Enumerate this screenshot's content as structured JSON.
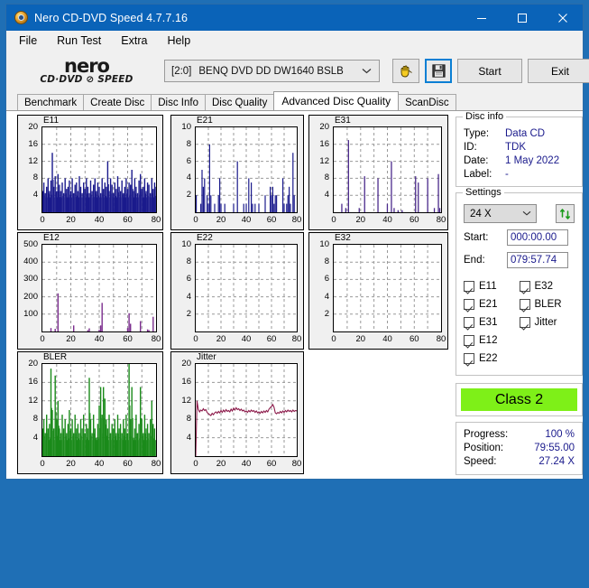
{
  "window": {
    "title": "Nero CD-DVD Speed 4.7.7.16",
    "icon": "nero-app-icon",
    "minimize": "minimize-icon",
    "maximize": "maximize-icon",
    "close": "close-icon"
  },
  "menu": [
    {
      "label": "File"
    },
    {
      "label": "Run Test"
    },
    {
      "label": "Extra"
    },
    {
      "label": "Help"
    }
  ],
  "logo": {
    "main": "nero",
    "sub": "CD·DVD ⊘ SPEED"
  },
  "toolbar": {
    "drive_id": "[2:0]",
    "drive_name": "BENQ DVD DD DW1640 BSLB",
    "dropdown_icon": "chevron-down-icon",
    "hand_icon": "eject-hand-icon",
    "save_icon": "floppy-save-icon",
    "start_label": "Start",
    "exit_label": "Exit"
  },
  "tabs": [
    {
      "label": "Benchmark",
      "active": false
    },
    {
      "label": "Create Disc",
      "active": false
    },
    {
      "label": "Disc Info",
      "active": false
    },
    {
      "label": "Disc Quality",
      "active": false
    },
    {
      "label": "Advanced Disc Quality",
      "active": true
    },
    {
      "label": "ScanDisc",
      "active": false
    }
  ],
  "disc_info": {
    "title": "Disc info",
    "type_label": "Type:",
    "type_value": "Data CD",
    "id_label": "ID:",
    "id_value": "TDK",
    "date_label": "Date:",
    "date_value": "1 May 2022",
    "label_label": "Label:",
    "label_value": "-"
  },
  "settings": {
    "title": "Settings",
    "speed": "24 X",
    "speed_chevron": "chevron-down-icon",
    "refresh_icon": "refresh-arrows-icon",
    "start_label": "Start:",
    "start_value": "000:00.00",
    "end_label": "End:",
    "end_value": "079:57.74",
    "checkboxes": [
      {
        "label": "E11",
        "checked": true
      },
      {
        "label": "E21",
        "checked": true
      },
      {
        "label": "E31",
        "checked": true
      },
      {
        "label": "E12",
        "checked": true
      },
      {
        "label": "E22",
        "checked": true
      },
      {
        "label": "E32",
        "checked": true
      },
      {
        "label": "BLER",
        "checked": true
      },
      {
        "label": "Jitter",
        "checked": true
      }
    ]
  },
  "result": {
    "class_label": "Class 2",
    "class_color": "#7ef018"
  },
  "progress": {
    "progress_label": "Progress:",
    "progress_value": "100 %",
    "position_label": "Position:",
    "position_value": "79:55.00",
    "speed_label": "Speed:",
    "speed_value": "27.24 X"
  },
  "chart_data": [
    {
      "type": "bar",
      "title": "E11",
      "xlabel": "",
      "ylabel": "",
      "color": "#1a1a8c",
      "xlim": [
        0,
        80
      ],
      "ylim": [
        0,
        20
      ],
      "xticks": [
        0,
        20,
        40,
        60,
        80
      ],
      "yticks": [
        4,
        8,
        12,
        16,
        20
      ],
      "grid": true,
      "x": [
        0,
        1,
        2,
        3,
        4,
        5,
        6,
        7,
        8,
        9,
        10,
        11,
        12,
        13,
        14,
        15,
        16,
        17,
        18,
        19,
        20,
        21,
        22,
        23,
        24,
        25,
        26,
        27,
        28,
        29,
        30,
        31,
        32,
        33,
        34,
        35,
        36,
        37,
        38,
        39,
        40,
        41,
        42,
        43,
        44,
        45,
        46,
        47,
        48,
        49,
        50,
        51,
        52,
        53,
        54,
        55,
        56,
        57,
        58,
        59,
        60,
        61,
        62,
        63,
        64,
        65,
        66,
        67,
        68,
        69,
        70,
        71,
        72,
        73,
        74,
        75,
        76,
        77,
        78,
        79,
        80
      ],
      "values": [
        5,
        7,
        4.5,
        6,
        8,
        5,
        7.5,
        14,
        6,
        8.5,
        5,
        9,
        6.5,
        5,
        7,
        4.5,
        8,
        5.5,
        6,
        7.5,
        5,
        8,
        4.5,
        6.5,
        7,
        5,
        8.5,
        6,
        4.5,
        7,
        5.5,
        8,
        6,
        4.5,
        7.5,
        5,
        6.5,
        8,
        5,
        7,
        6,
        4.5,
        8,
        5.5,
        7,
        6,
        12,
        5,
        8,
        6.5,
        4.5,
        7,
        5.5,
        8.5,
        6,
        5,
        7.5,
        4.5,
        6,
        8,
        5.5,
        7,
        6.5,
        10,
        5,
        8,
        6,
        4.5,
        7.5,
        9,
        5.5,
        6,
        8,
        5,
        7,
        6.5,
        4.5,
        8,
        5.5,
        7,
        6
      ]
    },
    {
      "type": "bar",
      "title": "E21",
      "xlabel": "",
      "ylabel": "",
      "color": "#1a1a8c",
      "xlim": [
        0,
        80
      ],
      "ylim": [
        0,
        10
      ],
      "xticks": [
        0,
        20,
        40,
        60,
        80
      ],
      "yticks": [
        2,
        4,
        6,
        8,
        10
      ],
      "grid": true,
      "x": [
        0,
        1,
        2,
        3,
        4,
        5,
        6,
        7,
        8,
        9,
        10,
        11,
        12,
        13,
        14,
        15,
        16,
        17,
        18,
        19,
        20,
        21,
        22,
        23,
        24,
        25,
        26,
        27,
        28,
        29,
        30,
        31,
        32,
        33,
        34,
        35,
        36,
        37,
        38,
        39,
        40,
        41,
        42,
        43,
        44,
        45,
        46,
        47,
        48,
        49,
        50,
        51,
        52,
        53,
        54,
        55,
        56,
        57,
        58,
        59,
        60,
        61,
        62,
        63,
        64,
        65,
        66,
        67,
        68,
        69,
        70,
        71,
        72,
        73,
        74,
        75,
        76,
        77,
        78,
        79,
        80
      ],
      "values": [
        2,
        0,
        0,
        0,
        1,
        5,
        3,
        4,
        0,
        2,
        1,
        8,
        2,
        0,
        0,
        1,
        0,
        0,
        2,
        4,
        1,
        0,
        0,
        1,
        0,
        0,
        0,
        0,
        0,
        0,
        1,
        0,
        0,
        6,
        0,
        0,
        0,
        0,
        1,
        0,
        1,
        0,
        4,
        0,
        3.5,
        1,
        0,
        1,
        0,
        0,
        1,
        0,
        0,
        0,
        0,
        2,
        0,
        0,
        0,
        3,
        2,
        3,
        1,
        2,
        2,
        0,
        0,
        0,
        0,
        4,
        1,
        0,
        1,
        2,
        3,
        1,
        0,
        7,
        2,
        0
      ]
    },
    {
      "type": "bar",
      "title": "E31",
      "xlabel": "",
      "ylabel": "",
      "color": "#4b2a8c",
      "xlim": [
        0,
        80
      ],
      "ylim": [
        0,
        20
      ],
      "xticks": [
        0,
        20,
        40,
        60,
        80
      ],
      "yticks": [
        4,
        8,
        12,
        16,
        20
      ],
      "grid": true,
      "x": [
        0,
        1,
        2,
        3,
        4,
        5,
        6,
        7,
        8,
        9,
        10,
        11,
        12,
        13,
        14,
        15,
        16,
        17,
        18,
        19,
        20,
        21,
        22,
        23,
        24,
        25,
        26,
        27,
        28,
        29,
        30,
        31,
        32,
        33,
        34,
        35,
        36,
        37,
        38,
        39,
        40,
        41,
        42,
        43,
        44,
        45,
        46,
        47,
        48,
        49,
        50,
        51,
        52,
        53,
        54,
        55,
        56,
        57,
        58,
        59,
        60,
        61,
        62,
        63,
        64,
        65,
        66,
        67,
        68,
        69,
        70,
        71,
        72,
        73,
        74,
        75,
        76,
        77,
        78,
        79,
        80
      ],
      "values": [
        0,
        0,
        0,
        0,
        0,
        0,
        2,
        0,
        0,
        1,
        0,
        17,
        0,
        0,
        0,
        0,
        0,
        0,
        0,
        1,
        0,
        0,
        0,
        8.5,
        0,
        0,
        0,
        0,
        0,
        0,
        0,
        0,
        0,
        8,
        0,
        0,
        0,
        0,
        0,
        0,
        2,
        0,
        0,
        12,
        0,
        1,
        0,
        0,
        0.5,
        0,
        0,
        0.5,
        0,
        0,
        0,
        0,
        0,
        0,
        0,
        0,
        0,
        8.5,
        0,
        7,
        0,
        0,
        0,
        0,
        0,
        0,
        8,
        0,
        0,
        0,
        0,
        1,
        0,
        0,
        9,
        1,
        0
      ]
    },
    {
      "type": "bar",
      "title": "E12",
      "xlabel": "",
      "ylabel": "",
      "color": "#7b2d8e",
      "xlim": [
        0,
        80
      ],
      "ylim": [
        0,
        500
      ],
      "xticks": [
        0,
        20,
        40,
        60,
        80
      ],
      "yticks": [
        100,
        200,
        300,
        400,
        500
      ],
      "grid": true,
      "x": [
        0,
        1,
        2,
        3,
        4,
        5,
        6,
        7,
        8,
        9,
        10,
        11,
        12,
        13,
        14,
        15,
        16,
        17,
        18,
        19,
        20,
        21,
        22,
        23,
        24,
        25,
        26,
        27,
        28,
        29,
        30,
        31,
        32,
        33,
        34,
        35,
        36,
        37,
        38,
        39,
        40,
        41,
        42,
        43,
        44,
        45,
        46,
        47,
        48,
        49,
        50,
        51,
        52,
        53,
        54,
        55,
        56,
        57,
        58,
        59,
        60,
        61,
        62,
        63,
        64,
        65,
        66,
        67,
        68,
        69,
        70,
        71,
        72,
        73,
        74,
        75,
        76,
        77,
        78,
        79,
        80
      ],
      "values": [
        0,
        0,
        0,
        0,
        0,
        0,
        20,
        0,
        0,
        15,
        0,
        220,
        0,
        0,
        0,
        0,
        0,
        0,
        0,
        0,
        0,
        0,
        35,
        0,
        0,
        0,
        0,
        0,
        0,
        0,
        0,
        0,
        8,
        18,
        0,
        0,
        0,
        0,
        0,
        0,
        10,
        35,
        165,
        0,
        0,
        0,
        0,
        0,
        0,
        0,
        0,
        0,
        0,
        0,
        0,
        0,
        0,
        0,
        0,
        0,
        20,
        105,
        45,
        0,
        0,
        0,
        0,
        0,
        0,
        60,
        0,
        0,
        0,
        0,
        12,
        8,
        0,
        0,
        85,
        0,
        0
      ]
    },
    {
      "type": "bar",
      "title": "E22",
      "xlabel": "",
      "ylabel": "",
      "color": "#1a1a8c",
      "xlim": [
        0,
        80
      ],
      "ylim": [
        0,
        10
      ],
      "xticks": [
        0,
        20,
        40,
        60,
        80
      ],
      "yticks": [
        2,
        4,
        6,
        8,
        10
      ],
      "grid": true,
      "x": [],
      "values": []
    },
    {
      "type": "bar",
      "title": "E32",
      "xlabel": "",
      "ylabel": "",
      "color": "#1a1a8c",
      "xlim": [
        0,
        80
      ],
      "ylim": [
        0,
        10
      ],
      "xticks": [
        0,
        20,
        40,
        60,
        80
      ],
      "yticks": [
        2,
        4,
        6,
        8,
        10
      ],
      "grid": true,
      "x": [],
      "values": []
    },
    {
      "type": "bar",
      "title": "BLER",
      "xlabel": "",
      "ylabel": "",
      "color": "#1a8a1a",
      "xlim": [
        0,
        80
      ],
      "ylim": [
        0,
        20
      ],
      "xticks": [
        0,
        20,
        40,
        60,
        80
      ],
      "yticks": [
        4,
        8,
        12,
        16,
        20
      ],
      "grid": true,
      "x": [
        0,
        1,
        2,
        3,
        4,
        5,
        6,
        7,
        8,
        9,
        10,
        11,
        12,
        13,
        14,
        15,
        16,
        17,
        18,
        19,
        20,
        21,
        22,
        23,
        24,
        25,
        26,
        27,
        28,
        29,
        30,
        31,
        32,
        33,
        34,
        35,
        36,
        37,
        38,
        39,
        40,
        41,
        42,
        43,
        44,
        45,
        46,
        47,
        48,
        49,
        50,
        51,
        52,
        53,
        54,
        55,
        56,
        57,
        58,
        59,
        60,
        61,
        62,
        63,
        64,
        65,
        66,
        67,
        68,
        69,
        70,
        71,
        72,
        73,
        74,
        75,
        76,
        77,
        78,
        79,
        80
      ],
      "values": [
        6,
        8,
        5,
        9,
        6,
        7,
        19,
        10,
        6,
        17.5,
        8,
        12,
        6,
        5,
        9,
        6,
        8,
        5,
        7,
        10,
        6,
        8,
        5,
        9,
        6,
        7,
        5,
        8,
        6,
        9,
        5,
        7,
        6,
        17,
        8,
        5,
        9,
        6,
        4,
        7,
        11,
        15,
        9,
        15,
        12.5,
        8,
        6,
        9,
        5,
        7,
        6,
        8,
        5,
        9,
        6,
        7,
        5,
        8,
        6,
        9,
        5,
        20,
        8,
        15,
        4,
        6,
        9,
        5,
        7,
        15,
        8,
        5,
        9,
        6,
        7,
        5,
        8,
        12,
        7,
        6
      ]
    },
    {
      "type": "line",
      "title": "Jitter",
      "xlabel": "",
      "ylabel": "",
      "color": "#8c1a4a",
      "xlim": [
        0,
        80
      ],
      "ylim": [
        0,
        20
      ],
      "xticks": [
        0,
        20,
        40,
        60,
        80
      ],
      "yticks": [
        4,
        8,
        12,
        16,
        20
      ],
      "grid": true,
      "x": [
        0,
        1,
        2,
        3,
        4,
        5,
        6,
        7,
        8,
        9,
        10,
        11,
        12,
        13,
        14,
        15,
        16,
        17,
        18,
        19,
        20,
        21,
        22,
        23,
        24,
        25,
        26,
        27,
        28,
        29,
        30,
        31,
        32,
        33,
        34,
        35,
        36,
        37,
        38,
        39,
        40,
        41,
        42,
        43,
        44,
        45,
        46,
        47,
        48,
        49,
        50,
        51,
        52,
        53,
        54,
        55,
        56,
        57,
        58,
        59,
        60,
        61,
        62,
        63,
        64,
        65,
        66,
        67,
        68,
        69,
        70,
        71,
        72,
        73,
        74,
        75,
        76,
        77,
        78,
        79,
        80
      ],
      "values": [
        0,
        12,
        10.2,
        9.6,
        10,
        9.8,
        10.3,
        9.9,
        10.1,
        9.5,
        9.2,
        9.0,
        8.8,
        9.3,
        9.0,
        9.4,
        9.6,
        9.3,
        9.7,
        9.4,
        9.9,
        9.5,
        10,
        9.6,
        10.1,
        9.7,
        9.9,
        9.6,
        10.2,
        9.8,
        10.4,
        10,
        10.5,
        10.1,
        10.3,
        9.9,
        10.2,
        9.8,
        10,
        9.6,
        9.8,
        9.5,
        9.9,
        9.6,
        10,
        9.7,
        9.9,
        9.5,
        9.8,
        9.4,
        9.6,
        9.3,
        9.7,
        9.4,
        9.8,
        9.5,
        9.9,
        9.6,
        10.2,
        10.5,
        10.8,
        11.2,
        10.6,
        9.4,
        9.2,
        9.5,
        9.3,
        9.7,
        9.4,
        9.8,
        9.5,
        9.9,
        9.6,
        10,
        9.7,
        9.9,
        9.6,
        10,
        9.7,
        9.9,
        9.8
      ]
    }
  ]
}
